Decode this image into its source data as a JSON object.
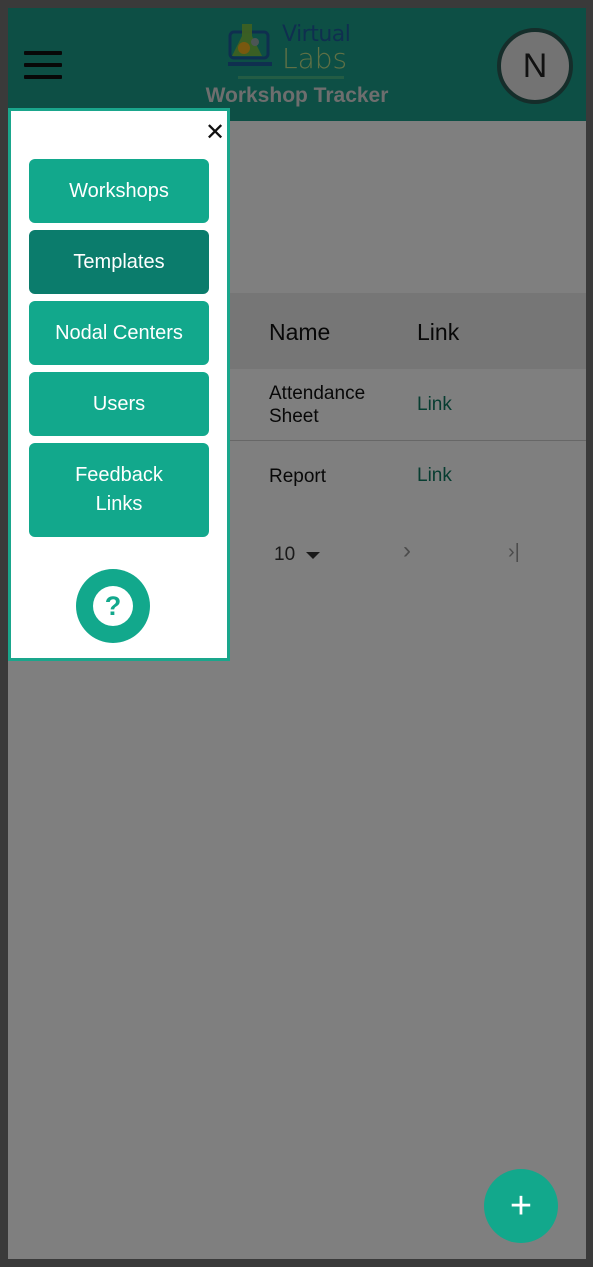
{
  "header": {
    "logo_line1": "Virtual",
    "logo_line2": "Labs",
    "title": "Workshop Tracker",
    "avatar_initial": "N"
  },
  "table": {
    "columns": [
      "Name",
      "Link"
    ],
    "rows": [
      {
        "name": "Attendance Sheet",
        "link": "Link"
      },
      {
        "name": "Report",
        "link": "Link"
      }
    ],
    "rows_per_page": "10"
  },
  "drawer": {
    "close_icon": "close-icon",
    "items": [
      {
        "label": "Workshops",
        "active": false
      },
      {
        "label": "Templates",
        "active": true
      },
      {
        "label": "Nodal Centers",
        "active": false
      },
      {
        "label": "Users",
        "active": false
      },
      {
        "label": "Feedback Links",
        "active": false
      }
    ],
    "help_label": "?"
  },
  "fab": {
    "label": "+"
  },
  "colors": {
    "accent": "#12a88c",
    "accent_active": "#0b7c6c",
    "header": "#1a9f8b",
    "link": "#0f7a63"
  }
}
